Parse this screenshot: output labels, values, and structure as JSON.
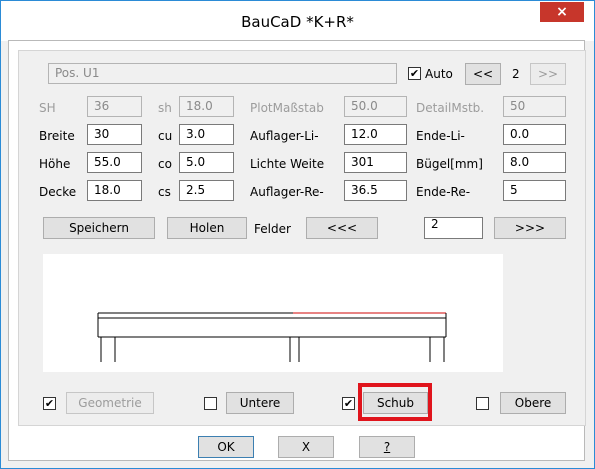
{
  "window": {
    "title": "BauCaD *K+R*",
    "close_label": "×"
  },
  "header": {
    "position": "Pos. U1",
    "auto_label": "Auto",
    "auto_checked": true,
    "prev_label": "<<",
    "page": "2",
    "next_label": ">>"
  },
  "row_sh": {
    "SH_label": "SH",
    "SH_value": "36",
    "sh_label": "sh",
    "sh_value": "18.0",
    "plot_label": "PlotMaßstab",
    "plot_value": "50.0",
    "detail_label": "DetailMstb.",
    "detail_value": "50"
  },
  "row_breite": {
    "label": "Breite",
    "value": "30",
    "cu_label": "cu",
    "cu_value": "3.0",
    "auflager_li_label": "Auflager-Li-",
    "auflager_li_value": "12.0",
    "ende_li_label": "Ende-Li-",
    "ende_li_value": "0.0"
  },
  "row_hoehe": {
    "label": "Höhe",
    "value": "55.0",
    "co_label": "co",
    "co_value": "5.0",
    "lichte_label": "Lichte Weite",
    "lichte_value": "301",
    "buegel_label": "Bügel[mm]",
    "buegel_value": "8.0"
  },
  "row_decke": {
    "label": "Decke",
    "value": "18.0",
    "cs_label": "cs",
    "cs_value": "2.5",
    "auflager_re_label": "Auflager-Re-",
    "auflager_re_value": "36.5",
    "ende_re_label": "Ende-Re-",
    "ende_re_value": "5"
  },
  "actions": {
    "speichern": "Speichern",
    "holen": "Holen",
    "felder_label": "Felder",
    "felder_prev": "<<<",
    "felder_value": "2",
    "felder_next": ">>>"
  },
  "options": [
    {
      "label": "Geometrie",
      "checked": true,
      "disabled": true
    },
    {
      "label": "Untere",
      "checked": false,
      "disabled": false
    },
    {
      "label": "Schub",
      "checked": true,
      "disabled": false
    },
    {
      "label": "Obere",
      "checked": false,
      "disabled": false
    }
  ],
  "footer": {
    "ok": "OK",
    "x": "X",
    "help": "?"
  }
}
